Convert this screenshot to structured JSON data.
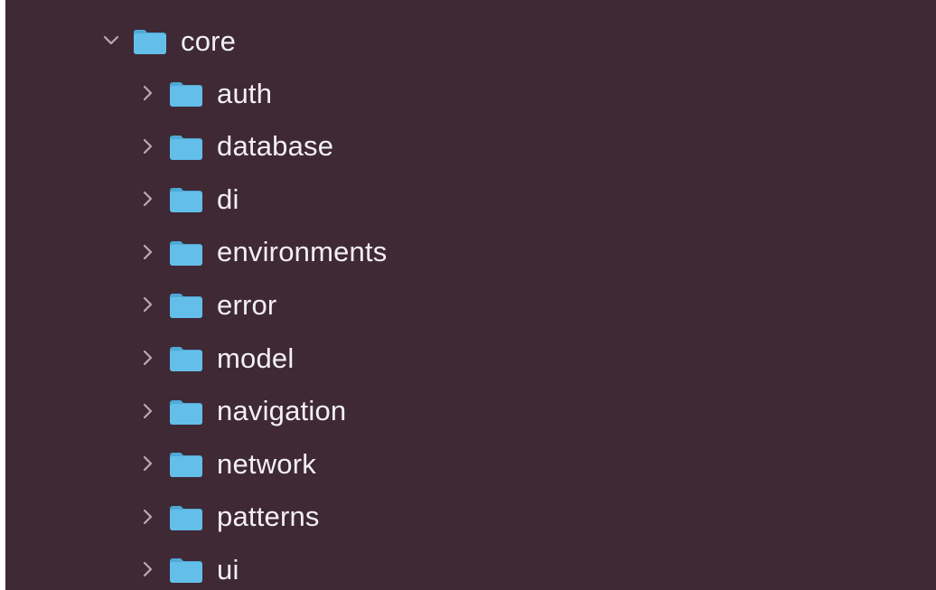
{
  "tree": {
    "root": {
      "label": "core",
      "expanded": true,
      "icon": "folder-icon",
      "chevron": "chevron-down-icon"
    },
    "children": [
      {
        "label": "auth",
        "expanded": false
      },
      {
        "label": "database",
        "expanded": false
      },
      {
        "label": "di",
        "expanded": false
      },
      {
        "label": "environments",
        "expanded": false
      },
      {
        "label": "error",
        "expanded": false
      },
      {
        "label": "model",
        "expanded": false
      },
      {
        "label": "navigation",
        "expanded": false
      },
      {
        "label": "network",
        "expanded": false
      },
      {
        "label": "patterns",
        "expanded": false
      },
      {
        "label": "ui",
        "expanded": false
      }
    ]
  },
  "colors": {
    "background": "#3f2935",
    "text": "#f3f0f2",
    "folder": "#63bfe9",
    "folder_tab": "#4fa9d6",
    "chevron": "#b9aab3"
  }
}
